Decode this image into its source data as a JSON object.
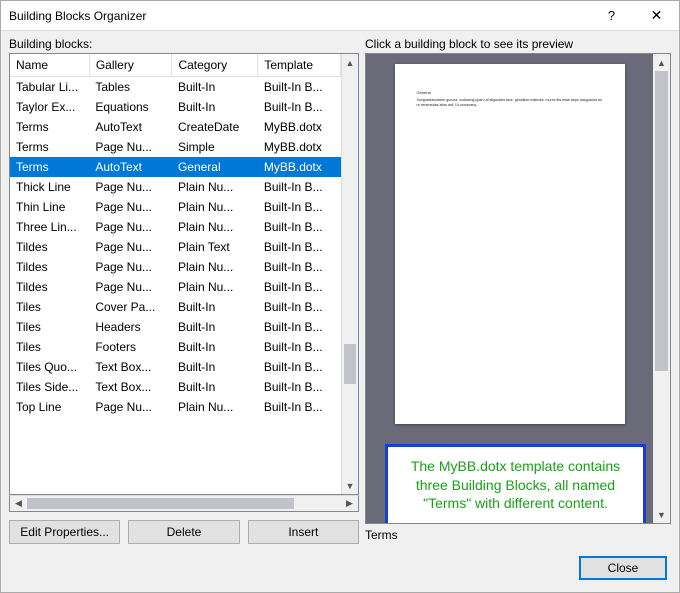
{
  "window": {
    "title": "Building Blocks Organizer",
    "help": "?",
    "close": "✕"
  },
  "left": {
    "label": "Building blocks:",
    "headers": [
      "Name",
      "Gallery",
      "Category",
      "Template"
    ],
    "colwidths": [
      "24%",
      "25%",
      "26%",
      "25%"
    ],
    "rows": [
      {
        "cells": [
          "Tabular Li...",
          "Tables",
          "Built-In",
          "Built-In B..."
        ],
        "selected": false
      },
      {
        "cells": [
          "Taylor Ex...",
          "Equations",
          "Built-In",
          "Built-In B..."
        ],
        "selected": false
      },
      {
        "cells": [
          "Terms",
          "AutoText",
          "CreateDate",
          "MyBB.dotx"
        ],
        "selected": false
      },
      {
        "cells": [
          "Terms",
          "Page Nu...",
          "Simple",
          "MyBB.dotx"
        ],
        "selected": false
      },
      {
        "cells": [
          "Terms",
          "AutoText",
          "General",
          "MyBB.dotx"
        ],
        "selected": true
      },
      {
        "cells": [
          "Thick Line",
          "Page Nu...",
          "Plain Nu...",
          "Built-In B..."
        ],
        "selected": false
      },
      {
        "cells": [
          "Thin Line",
          "Page Nu...",
          "Plain Nu...",
          "Built-In B..."
        ],
        "selected": false
      },
      {
        "cells": [
          "Three Lin...",
          "Page Nu...",
          "Plain Nu...",
          "Built-In B..."
        ],
        "selected": false
      },
      {
        "cells": [
          "Tildes",
          "Page Nu...",
          "Plain Text",
          "Built-In B..."
        ],
        "selected": false
      },
      {
        "cells": [
          "Tildes",
          "Page Nu...",
          "Plain Nu...",
          "Built-In B..."
        ],
        "selected": false
      },
      {
        "cells": [
          "Tildes",
          "Page Nu...",
          "Plain Nu...",
          "Built-In B..."
        ],
        "selected": false
      },
      {
        "cells": [
          "Tiles",
          "Cover Pa...",
          "Built-In",
          "Built-In B..."
        ],
        "selected": false
      },
      {
        "cells": [
          "Tiles",
          "Headers",
          "Built-In",
          "Built-In B..."
        ],
        "selected": false
      },
      {
        "cells": [
          "Tiles",
          "Footers",
          "Built-In",
          "Built-In B..."
        ],
        "selected": false
      },
      {
        "cells": [
          "Tiles Quo...",
          "Text Box...",
          "Built-In",
          "Built-In B..."
        ],
        "selected": false
      },
      {
        "cells": [
          "Tiles Side...",
          "Text Box...",
          "Built-In",
          "Built-In B..."
        ],
        "selected": false
      },
      {
        "cells": [
          "Top Line",
          "Page Nu...",
          "Plain Nu...",
          "Built-In B..."
        ],
        "selected": false
      }
    ],
    "buttons": {
      "edit": "Edit Properties...",
      "delete": "Delete",
      "insert": "Insert"
    }
  },
  "right": {
    "label": "Click a building block to see its preview",
    "preview_header": "General",
    "preview_body": "Sungratdasudaror guruca, codiacing uparu at stiguldars tace, girodlium maticies, murex fits esae aeps nauguarud aure venerautas alias axil. Ut occumany.",
    "callout": "The MyBB.dotx template contains three Building Blocks, all named \"Terms\" with different content.\n\nApparently, the first one created is the one used unless Gallery and Category are specified.",
    "preview_name": "Terms"
  },
  "footer": {
    "close": "Close"
  }
}
